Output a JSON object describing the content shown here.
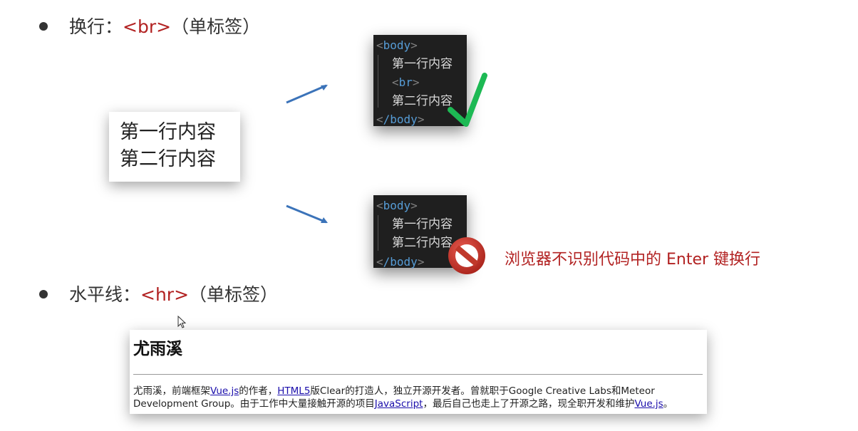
{
  "br_heading": {
    "label": "换行：",
    "tag": "<br>",
    "note": "（单标签）"
  },
  "render_example": {
    "line1": "第一行内容",
    "line2": "第二行内容"
  },
  "code_good": {
    "open_tag": "body",
    "line1": "第一行内容",
    "br_tag": "br",
    "line2": "第二行内容",
    "close_tag": "/body"
  },
  "code_bad": {
    "open_tag": "body",
    "line1": "第一行内容",
    "line2": "第二行内容",
    "close_tag": "/body"
  },
  "warning_text": "浏览器不识别代码中的 Enter 键换行",
  "hr_heading": {
    "label": "水平线：",
    "tag": "<hr>",
    "note": "（单标签）"
  },
  "hr_example": {
    "title": "尤雨溪",
    "p1": "尤雨溪，前端框架",
    "link1": "Vue.js",
    "p2": "的作者，",
    "link2": "HTML5",
    "p3": "版Clear的打造人，独立开源开发者。曾就职于Google Creative Labs和Meteor Development Group。由于工作中大量接触开源的项目",
    "link3": "JavaScript",
    "p4": "，最后自己也走上了开源之路，现全职开发和维护",
    "link4": "Vue.js",
    "p5": "。"
  },
  "colors": {
    "accent_red": "#b22222",
    "check_green": "#1db954",
    "stop_red": "#c0392b",
    "arrow_blue": "#3b73b9",
    "code_bg": "#1f1f1f",
    "tag_blue": "#569cd6"
  },
  "icons": [
    "check-icon",
    "prohibited-icon",
    "arrow-icon",
    "cursor-icon"
  ]
}
